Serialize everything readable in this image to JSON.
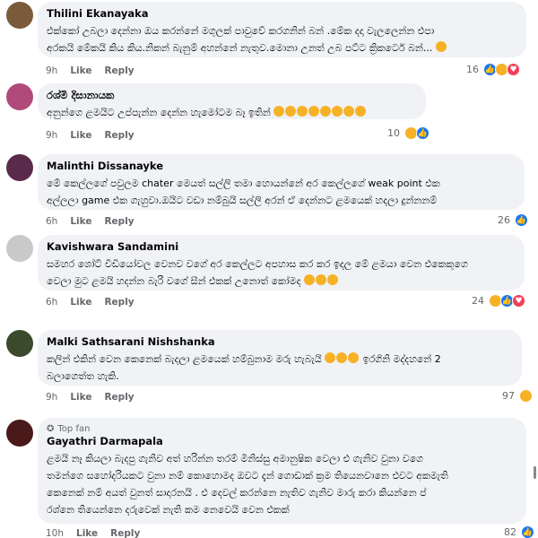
{
  "comments": [
    {
      "author": "Thilini Ekanayaka",
      "lines": [
        "එක්කෝ උබලා දෙන්නා ඔය කරන්නේ මගුලක් පාවුවේ කරගනින් බන් .මේක දදා වැලලෙන්න එපා",
        "අරකයි මේකයි කිය කිය.නිකන් බැනුම් අහන්නේ නැතුව.මොනා උනත් උබ පට්ට ක්‍රිකටෙර් බන්..."
      ],
      "time": "9h",
      "like": "Like",
      "reply": "Reply",
      "count": "16",
      "reactions": [
        "like",
        "haha",
        "love"
      ],
      "avatar_color": "#7a5a3a"
    },
    {
      "author": "රශ්මි දිසානායක",
      "lines": [
        "අනුන්ගෙ ළමයිට උප්පැන්න දෙන්න හැමෝටම බෑ ඉතින්"
      ],
      "time": "9h",
      "like": "Like",
      "reply": "Reply",
      "count": "10",
      "reactions": [
        "haha",
        "like"
      ],
      "avatar_color": "#b04a7a"
    },
    {
      "author": "Malinthi Dissanayke",
      "lines": [
        "මේ කෙල්ලගේ පවුලම chater මෙයත් සල්ලි තමා හොයන්නේ අර කෙල්ලගේ weak point එක",
        "අල්ලලා game එක ගැහුවා.ඔයිට වඩා නම්බුයි සල්ලි අරන් ඒ දෙන්නට ළමයෙක් හදලා දුන්නනම්"
      ],
      "time": "6h",
      "like": "Like",
      "reply": "Reply",
      "count": "26",
      "reactions": [
        "like"
      ],
      "avatar_color": "#5a2a4a"
    },
    {
      "author": "Kavishwara Sandamini",
      "lines": [
        "සමහර ශෝට් වීඩියෝවල වෙනව වගේ අර කෙල්ලට අපහාස කර කර ඉදල මේ ළමයා වෙන එකෙකුගෙ",
        "වෙලා මුට ළමයි හදන්න බැරි වගේ සීන් එකක් උනොත් කෝමද"
      ],
      "time": "6h",
      "like": "Like",
      "reply": "Reply",
      "count": "24",
      "reactions": [
        "haha",
        "like",
        "love"
      ],
      "avatar_color": "#c9c9c9"
    },
    {
      "author": "Malki Sathsarani Nishshanka",
      "lines": [
        "කලින් එකින් වෙන කෙනෙක් බැදලා ළමයෙක් හම්බුනාම මරු හැබැයි",
        "බලාගෙත්ත හැකි."
      ],
      "line1_tail": "ඉරගිනි මද්දහනේ 2",
      "time": "9h",
      "like": "Like",
      "reply": "Reply",
      "count": "97",
      "reactions": [
        "haha"
      ],
      "avatar_color": "#3a4a2a"
    },
    {
      "topfan": "Top fan",
      "author": "Gayathri Darmapala",
      "lines": [
        "ළමයි නෑ කියලා බැදපු ගැනිව අත් හරින්න තරම් මිනිස්සු අමානුෂික වෙලා එ ගැනිව වුනා වගෙ",
        "තමන්ගෙ සහෝදරියකට වුනා නම් කොහොමද ඔවට දැන් ගොඩාක් ක්‍රම තියෙනවානෙ එවට අකමැති",
        "කෙනෙක් නම් අයත් වුනත් සාදාරනයි . එ දෙවල් කරන්නෙ නැතිව ගැනිව මාරු කරා කියන්නෙ ප්",
        "රශ්නෙ තියෙන්නෙ දරුවෙක් නැති කම නෙවෙයි වෙන එකක්"
      ],
      "time": "10h",
      "like": "Like",
      "reply": "Reply",
      "count": "82",
      "reactions": [
        "like"
      ],
      "avatar_color": "#4a1a1a"
    }
  ]
}
